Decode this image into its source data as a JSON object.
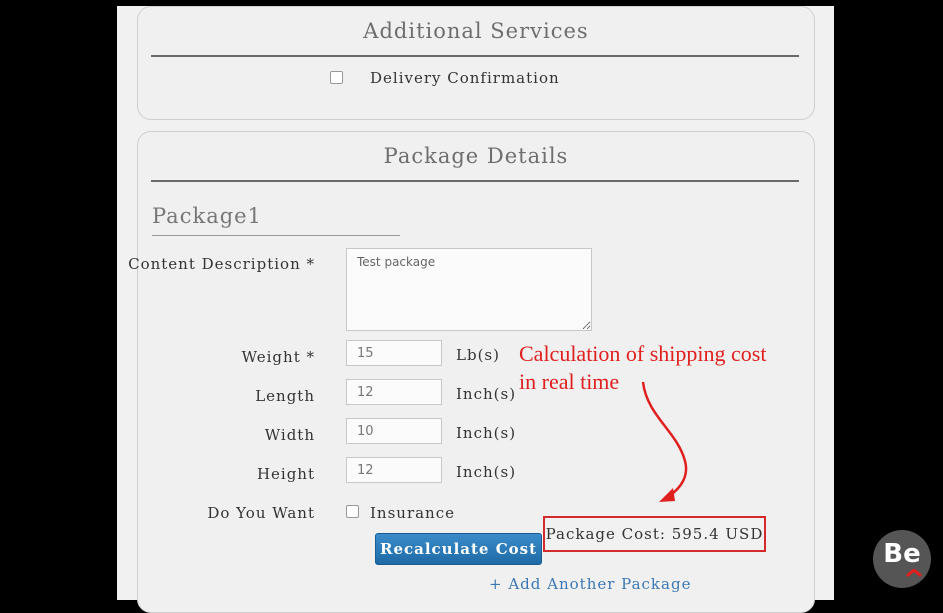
{
  "additional_services": {
    "title": "Additional Services",
    "delivery_confirmation_label": "Delivery Confirmation"
  },
  "package_details": {
    "title": "Package Details",
    "package_heading": "Package1",
    "content_description_label": "Content Description *",
    "content_description_value": "Test package",
    "weight_label": "Weight *",
    "weight_value": "15",
    "weight_unit": "Lb(s)",
    "length_label": "Length",
    "length_value": "12",
    "length_unit": "Inch(s)",
    "width_label": "Width",
    "width_value": "10",
    "width_unit": "Inch(s)",
    "height_label": "Height",
    "height_value": "12",
    "height_unit": "Inch(s)",
    "do_you_want_label": "Do You Want",
    "insurance_label": "Insurance",
    "recalculate_label": "Recalculate Cost",
    "add_package_label": "+ Add Another Package"
  },
  "annotation": {
    "line1": "Calculation of shipping cost",
    "line2": "in real time",
    "package_cost": "Package Cost: 595.4 USD"
  },
  "logo_text": "Be",
  "colors": {
    "annotation": "#e0201f",
    "button": "#2a7dbf",
    "link": "#3a78b5"
  }
}
